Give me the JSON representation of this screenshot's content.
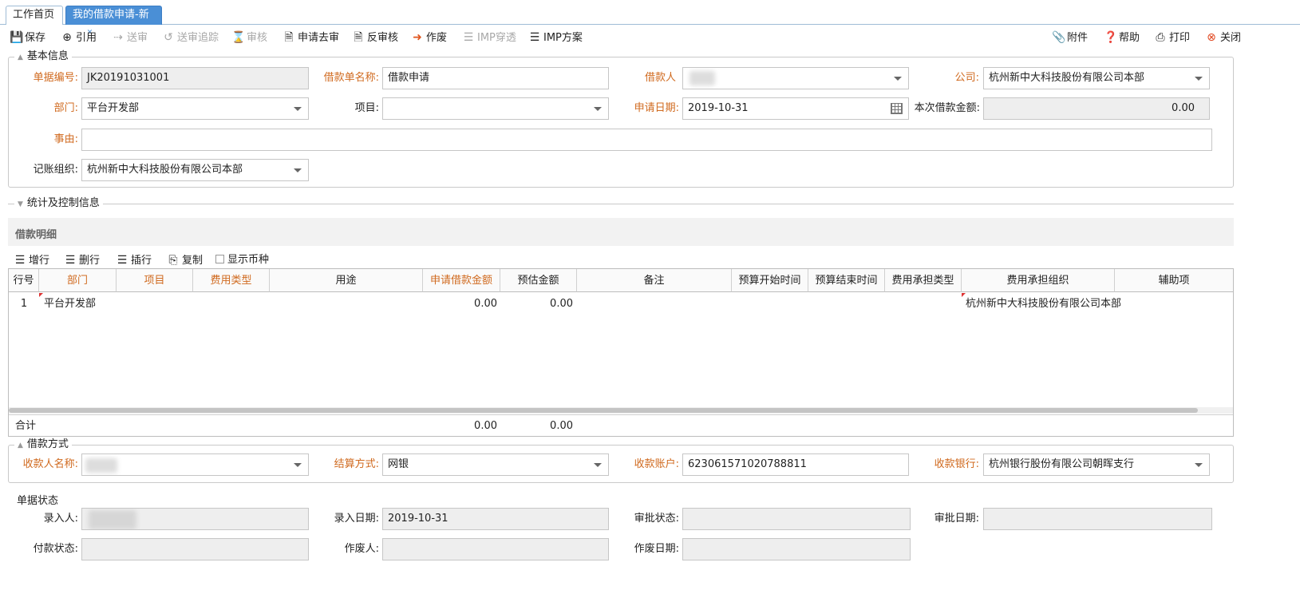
{
  "tabs": {
    "home": "工作首页",
    "active": "我的借款申请-新增"
  },
  "toolbar": {
    "save": "保存",
    "quote": "引用",
    "submit": "送审",
    "track": "送审追踪",
    "review": "审核",
    "apply_review": "申请去审",
    "unreview": "反审核",
    "void": "作废",
    "imp_through": "IMP穿透",
    "imp_plan": "IMP方案",
    "attach": "附件",
    "help": "帮助",
    "print": "打印",
    "close": "关闭"
  },
  "basic": {
    "title": "基本信息",
    "doc_no_label": "单据编号:",
    "doc_no": "JK20191031001",
    "name_label": "借款单名称:",
    "name": "借款申请",
    "borrower_label": "借款人",
    "company_label": "公司:",
    "company": "杭州新中大科技股份有限公司本部",
    "dept_label": "部门:",
    "dept": "平台开发部",
    "project_label": "项目:",
    "project": "",
    "date_label": "申请日期:",
    "date": "2019-10-31",
    "amount_label": "本次借款金额:",
    "amount": "0.00",
    "reason_label": "事由:",
    "reason": "",
    "acct_org_label": "记账组织:",
    "acct_org": "杭州新中大科技股份有限公司本部"
  },
  "stats": {
    "title": "统计及控制信息"
  },
  "detail": {
    "title": "借款明细",
    "actions": {
      "add": "增行",
      "delete": "删行",
      "insert": "插行",
      "copy": "复制",
      "show_currency": "显示币种"
    },
    "columns": [
      "行号",
      "部门",
      "项目",
      "费用类型",
      "用途",
      "申请借款金额",
      "预估金额",
      "备注",
      "预算开始时间",
      "预算结束时间",
      "费用承担类型",
      "费用承担组织",
      "辅助项"
    ],
    "rows": [
      {
        "no": "1",
        "dept": "平台开发部",
        "apply_amount": "0.00",
        "estimate": "0.00",
        "org": "杭州新中大科技股份有限公司本部"
      }
    ],
    "total_label": "合计",
    "total_apply": "0.00",
    "total_estimate": "0.00"
  },
  "payment": {
    "title": "借款方式",
    "payee_label": "收款人名称:",
    "method_label": "结算方式:",
    "method": "网银",
    "account_label": "收款账户:",
    "account": "623061571020788811",
    "bank_label": "收款银行:",
    "bank": "杭州银行股份有限公司朝晖支行"
  },
  "status": {
    "title": "单据状态",
    "entry_by_label": "录入人:",
    "entry_date_label": "录入日期:",
    "entry_date": "2019-10-31",
    "approve_status_label": "审批状态:",
    "approve_status": "",
    "approve_date_label": "审批日期:",
    "approve_date": "",
    "pay_status_label": "付款状态:",
    "pay_status": "",
    "void_by_label": "作废人:",
    "void_by": "",
    "void_date_label": "作废日期:",
    "void_date": ""
  },
  "colors": {
    "required": "#d06a1f",
    "tab_active": "#4a8fd6",
    "readonly_bg": "#eeeeee"
  }
}
